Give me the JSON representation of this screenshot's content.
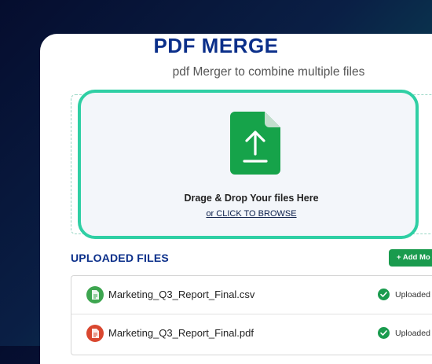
{
  "header": {
    "title": "PDF MERGE",
    "subtitle": "pdf Merger to combine multiple files"
  },
  "dropzone": {
    "icon": "file-upload-icon",
    "instruction": "Drage & Drop Your files Here",
    "browse_label": "or CLICK TO BROWSE"
  },
  "uploaded": {
    "heading": "UPLOADED FILES",
    "add_button": "+ Add Mo",
    "files": [
      {
        "name": "Marketing_Q3_Report_Final.csv",
        "type_icon": "csv-file-icon",
        "status": "Uploaded",
        "icon_color": "#3da54f"
      },
      {
        "name": "Marketing_Q3_Report_Final.pdf",
        "type_icon": "pdf-file-icon",
        "status": "Uploaded",
        "icon_color": "#d9472f"
      }
    ]
  },
  "colors": {
    "accent": "#2fcfa4",
    "title": "#0b2f8a",
    "button": "#1a9b4e",
    "success": "#1a9b4e"
  }
}
